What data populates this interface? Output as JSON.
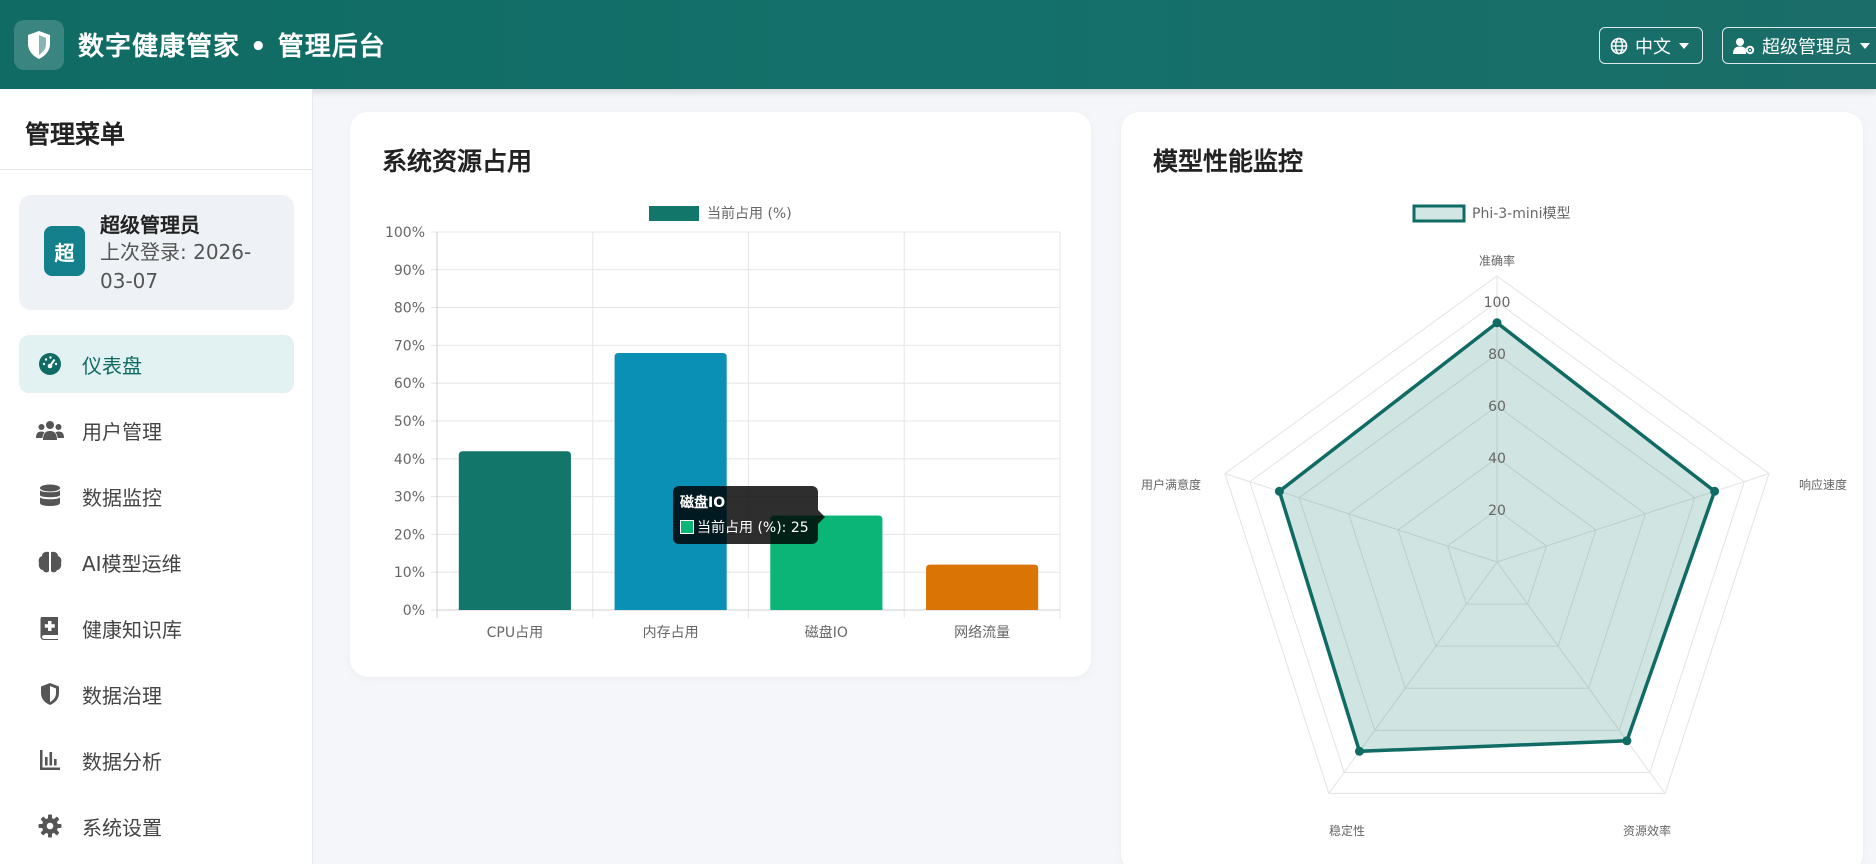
{
  "header": {
    "title": "数字健康管家 • 管理后台",
    "language": "中文",
    "user": "超级管理员"
  },
  "sidebar": {
    "title": "管理菜单",
    "profile": {
      "avatar_text": "超",
      "name": "超级管理员",
      "last_login": "上次登录: 2026-03-07"
    },
    "items": [
      {
        "label": "仪表盘",
        "icon": "dashboard-icon",
        "active": true
      },
      {
        "label": "用户管理",
        "icon": "users-icon"
      },
      {
        "label": "数据监控",
        "icon": "database-icon"
      },
      {
        "label": "AI模型运维",
        "icon": "brain-icon"
      },
      {
        "label": "健康知识库",
        "icon": "medical-book-icon"
      },
      {
        "label": "数据治理",
        "icon": "shield-icon"
      },
      {
        "label": "数据分析",
        "icon": "bar-chart-icon"
      },
      {
        "label": "系统设置",
        "icon": "gear-icon"
      }
    ]
  },
  "colors": {
    "primary": "#0f6b63",
    "cpu": "#13766b",
    "memory": "#0a90b5",
    "disk": "#0bb578",
    "network": "#d97405"
  },
  "tooltip": {
    "title": "磁盘IO",
    "text": "当前占用 (%): 25"
  },
  "chart_data": [
    {
      "type": "bar",
      "title": "系统资源占用",
      "categories": [
        "CPU占用",
        "内存占用",
        "磁盘IO",
        "网络流量"
      ],
      "series": [
        {
          "name": "当前占用 (%)",
          "values": [
            42,
            68,
            25,
            12
          ]
        }
      ],
      "ylim": [
        0,
        100
      ],
      "yticks": [
        "0%",
        "10%",
        "20%",
        "30%",
        "40%",
        "50%",
        "60%",
        "70%",
        "80%",
        "90%",
        "100%"
      ],
      "grid": true,
      "legend": "top-center"
    },
    {
      "type": "radar",
      "title": "模型性能监控",
      "axes": [
        "准确率",
        "响应速度",
        "资源效率",
        "稳定性",
        "用户满意度"
      ],
      "series": [
        {
          "name": "Phi-3-mini模型",
          "values": [
            92,
            88,
            85,
            90,
            88
          ]
        }
      ],
      "rlim": [
        0,
        100
      ],
      "rticks": [
        "20",
        "40",
        "60",
        "80",
        "100"
      ],
      "legend": "top-center"
    }
  ]
}
